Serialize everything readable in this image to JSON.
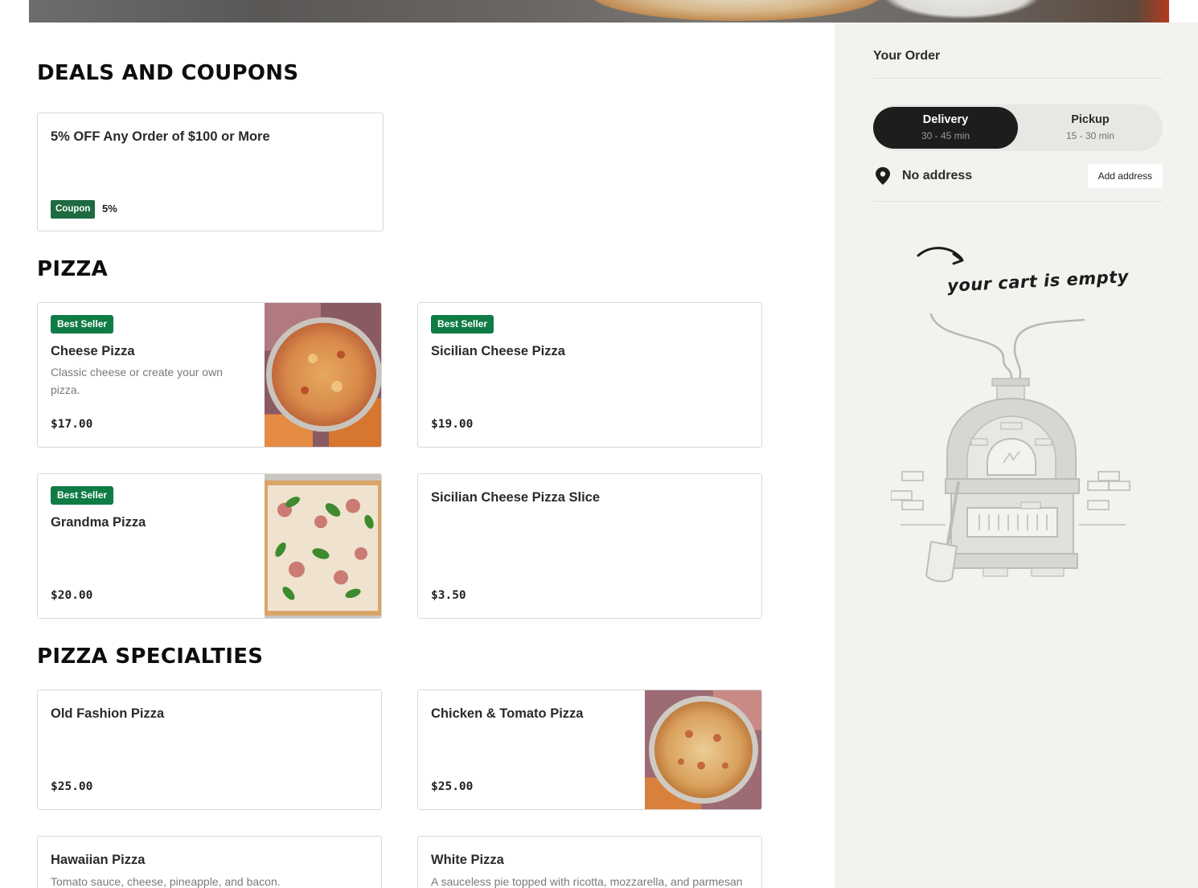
{
  "sections": {
    "deals": {
      "title": "DEALS AND COUPONS"
    },
    "pizza": {
      "title": "PIZZA"
    },
    "specialties": {
      "title": "PIZZA SPECIALTIES"
    }
  },
  "coupon": {
    "name": "5% OFF Any Order of $100 or More",
    "badge": "Coupon",
    "percent": "5%"
  },
  "pizza_items": [
    {
      "badge": "Best Seller",
      "name": "Cheese Pizza",
      "desc": "Classic cheese or create your own pizza.",
      "price": "$17.00"
    },
    {
      "badge": "Best Seller",
      "name": "Sicilian Cheese Pizza",
      "price": "$19.00"
    },
    {
      "badge": "Best Seller",
      "name": "Grandma Pizza",
      "price": "$20.00"
    },
    {
      "name": "Sicilian Cheese Pizza Slice",
      "price": "$3.50"
    }
  ],
  "specialty_items": [
    {
      "name": "Old Fashion Pizza",
      "price": "$25.00"
    },
    {
      "name": "Chicken & Tomato Pizza",
      "price": "$25.00"
    },
    {
      "name": "Hawaiian Pizza",
      "desc": "Tomato sauce, cheese, pineapple, and bacon."
    },
    {
      "name": "White Pizza",
      "desc": "A sauceless pie topped with ricotta, mozzarella, and parmesan"
    }
  ],
  "order": {
    "title": "Your Order",
    "delivery": {
      "label": "Delivery",
      "time": "30 - 45 min"
    },
    "pickup": {
      "label": "Pickup",
      "time": "15 - 30 min"
    },
    "address": "No address",
    "add_address": "Add address",
    "empty_message": "your cart is empty"
  },
  "colors": {
    "badge_green": "#0f7c45",
    "sidebar_bg": "#f3f2ef",
    "active_toggle": "#1d1d1d"
  }
}
